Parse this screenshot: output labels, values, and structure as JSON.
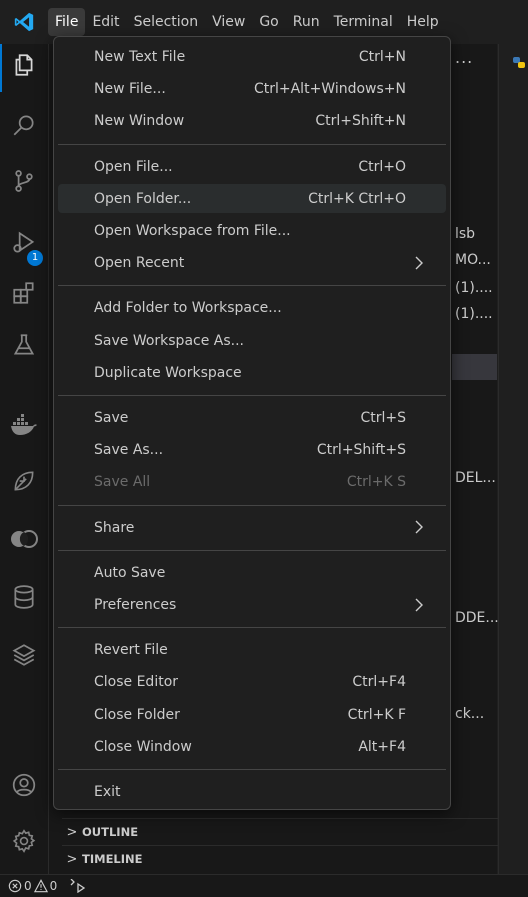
{
  "menubar": {
    "items": [
      "File",
      "Edit",
      "Selection",
      "View",
      "Go",
      "Run",
      "Terminal",
      "Help"
    ],
    "active": "File"
  },
  "activity": {
    "debug_badge": "1"
  },
  "sidebar": {
    "header_more": "...",
    "peek_lines": [
      "lsb",
      "MO...",
      "(1)....",
      "(1)....",
      "DEL...",
      "DDE...",
      "ck..."
    ]
  },
  "file_menu": {
    "groups": [
      [
        {
          "label": "New Text File",
          "shortcut": "Ctrl+N"
        },
        {
          "label": "New File...",
          "shortcut": "Ctrl+Alt+Windows+N"
        },
        {
          "label": "New Window",
          "shortcut": "Ctrl+Shift+N"
        }
      ],
      [
        {
          "label": "Open File...",
          "shortcut": "Ctrl+O"
        },
        {
          "label": "Open Folder...",
          "shortcut": "Ctrl+K Ctrl+O",
          "state": "hover"
        },
        {
          "label": "Open Workspace from File...",
          "shortcut": ""
        },
        {
          "label": "Open Recent",
          "shortcut": "",
          "submenu": true
        }
      ],
      [
        {
          "label": "Add Folder to Workspace...",
          "shortcut": ""
        },
        {
          "label": "Save Workspace As...",
          "shortcut": ""
        },
        {
          "label": "Duplicate Workspace",
          "shortcut": ""
        }
      ],
      [
        {
          "label": "Save",
          "shortcut": "Ctrl+S"
        },
        {
          "label": "Save As...",
          "shortcut": "Ctrl+Shift+S"
        },
        {
          "label": "Save All",
          "shortcut": "Ctrl+K S",
          "state": "disabled"
        }
      ],
      [
        {
          "label": "Share",
          "shortcut": "",
          "submenu": true
        }
      ],
      [
        {
          "label": "Auto Save",
          "shortcut": ""
        },
        {
          "label": "Preferences",
          "shortcut": "",
          "submenu": true
        }
      ],
      [
        {
          "label": "Revert File",
          "shortcut": ""
        },
        {
          "label": "Close Editor",
          "shortcut": "Ctrl+F4"
        },
        {
          "label": "Close Folder",
          "shortcut": "Ctrl+K F"
        },
        {
          "label": "Close Window",
          "shortcut": "Alt+F4"
        }
      ],
      [
        {
          "label": "Exit",
          "shortcut": ""
        }
      ]
    ]
  },
  "panels": [
    {
      "label": "OUTLINE"
    },
    {
      "label": "TIMELINE"
    }
  ],
  "statusbar": {
    "errors": "0",
    "warnings": "0"
  },
  "colors": {
    "accent": "#0078d4",
    "menu_bg": "#1f1f1f",
    "hover_bg": "#2a2d2e"
  }
}
